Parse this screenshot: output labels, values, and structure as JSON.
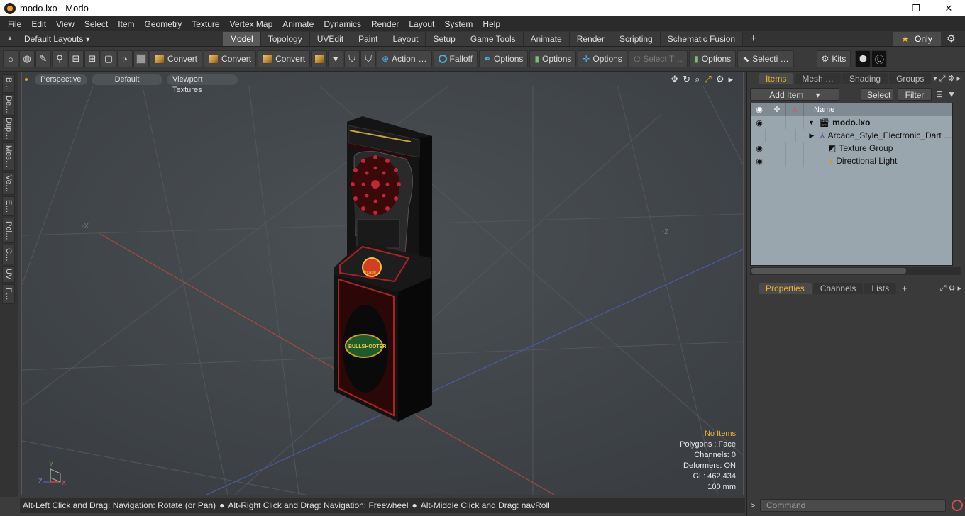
{
  "window": {
    "title": "modo.lxo - Modo",
    "minimize": "—",
    "maximize": "❐",
    "close": "✕"
  },
  "menu": [
    "File",
    "Edit",
    "View",
    "Select",
    "Item",
    "Geometry",
    "Texture",
    "Vertex Map",
    "Animate",
    "Dynamics",
    "Render",
    "Layout",
    "System",
    "Help"
  ],
  "layoutbar": {
    "layout_select": "Default Layouts ▾",
    "tabs": [
      "Model",
      "Topology",
      "UVEdit",
      "Paint",
      "Layout",
      "Setup",
      "Game Tools",
      "Animate",
      "Render",
      "Scripting",
      "Schematic Fusion"
    ],
    "active_tab": "Model",
    "plus": "+",
    "only_label": "Only",
    "star": "★",
    "gear": "⚙"
  },
  "toolbar": {
    "convert1": "Convert",
    "convert2": "Convert",
    "convert3": "Convert",
    "action": "Action",
    "action_more": "…",
    "falloff": "Falloff",
    "options1": "Options",
    "options2": "Options",
    "options3": "Options",
    "select_t": "Select T…",
    "options4": "Options",
    "selecti": "Selecti …",
    "kits": "Kits"
  },
  "lefttabs": [
    "B…",
    "De…",
    "Dup…",
    "Mes…",
    "Ve…",
    "E…",
    "Pol…",
    "C…",
    "UV",
    "F…"
  ],
  "viewport": {
    "view_mode": "Perspective",
    "shading": "Default",
    "textures": "Viewport Textures",
    "info": {
      "no_items": "No Items",
      "polygons": "Polygons : Face",
      "channels": "Channels: 0",
      "deformers": "Deformers: ON",
      "gl": "GL: 462,434",
      "scale": "100 mm"
    },
    "axis_x": "-X",
    "axis_z": "-Z",
    "gizmo": {
      "y": "Y",
      "z": "Z",
      "x": "X"
    },
    "marquee_text": "Arcade",
    "logo_text": "BULLSHOOTER"
  },
  "statusbar": {
    "hint1": "Alt-Left Click and Drag: Navigation: Rotate (or Pan)",
    "hint2": "Alt-Right Click and Drag: Navigation: Freewheel",
    "hint3": "Alt-Middle Click and Drag: navRoll"
  },
  "items_panel": {
    "tabs": [
      "Items",
      "Mesh …",
      "Shading",
      "Groups"
    ],
    "active_tab": "Items",
    "add_item": "Add Item",
    "select": "Select",
    "filter": "Filter",
    "column_name": "Name",
    "rows": [
      {
        "name": "modo.lxo",
        "bold": true,
        "eye": true
      },
      {
        "name": "Arcade_Style_Electronic_Dart …",
        "eye": false
      },
      {
        "name": "Texture Group",
        "eye": true
      },
      {
        "name": "Directional Light",
        "eye": true
      }
    ]
  },
  "properties_panel": {
    "tabs": [
      "Properties",
      "Channels",
      "Lists"
    ],
    "active_tab": "Properties",
    "plus": "+"
  },
  "command": {
    "placeholder": "Command",
    "prompt": ">"
  }
}
